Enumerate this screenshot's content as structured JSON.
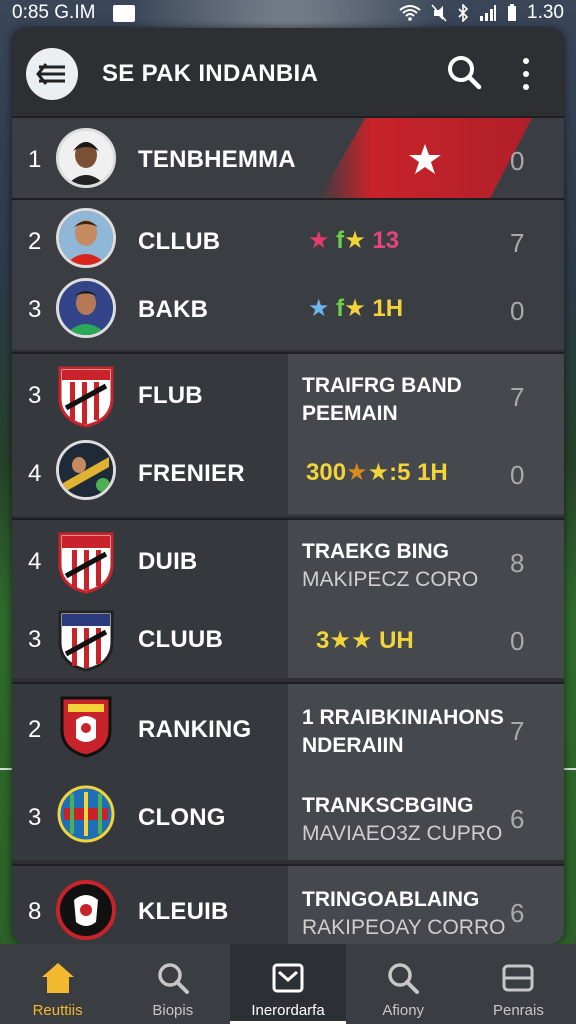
{
  "status_bar": {
    "time": "0:85 G.IM",
    "battery_time": "1.30"
  },
  "header": {
    "title": "SE PAK INDANBIA"
  },
  "rows": [
    {
      "rank": "1",
      "name": "TENBHEMMA",
      "stats": "",
      "score": "0"
    },
    {
      "rank": "2",
      "name": "CLLUB",
      "stats": "13",
      "score": "7"
    },
    {
      "rank": "3",
      "name": "BAKB",
      "stats": "1H",
      "score": "0"
    },
    {
      "rank": "3",
      "name": "FLUB",
      "info_line1": "TRAIFRG BAND",
      "info_line2": "PEEMAIN",
      "score": "7"
    },
    {
      "rank": "4",
      "name": "FRENIER",
      "stats": ":5 1H",
      "stats_prefix": "300",
      "score": "0"
    },
    {
      "rank": "4",
      "name": "DUIB",
      "info_line1": "TRAEKG BING",
      "info_line2": "MAKIPECZ CORO",
      "score": "8"
    },
    {
      "rank": "3",
      "name": "CLUUB",
      "stats": "UH",
      "stats_prefix": "3",
      "score": "0"
    },
    {
      "rank": "2",
      "name": "RANKING",
      "info_line1": "1 RRAIBKINIAHONS",
      "info_line2": "NDERAIIN",
      "score": "7"
    },
    {
      "rank": "3",
      "name": "CLONG",
      "info_line1": "TRANKSCBGING",
      "info_line2": "MAVIAEO3Z CUPRO",
      "score": "6"
    },
    {
      "rank": "8",
      "name": "KLEUIB",
      "info_line1": "TRINGOABLAING",
      "info_line2": "RAKIPEOAY CORRO",
      "score": "6"
    }
  ],
  "nav": [
    {
      "label": "Reuttiis",
      "icon": "home-icon"
    },
    {
      "label": "Biopis",
      "icon": "search-icon"
    },
    {
      "label": "Inerordarfa",
      "icon": "inbox-icon"
    },
    {
      "label": "Afiony",
      "icon": "search-icon"
    },
    {
      "label": "Penrais",
      "icon": "tablet-icon"
    }
  ],
  "colors": {
    "accent": "#f2b82e",
    "panel": "#2d2f33",
    "red_band": "#c8232a"
  }
}
